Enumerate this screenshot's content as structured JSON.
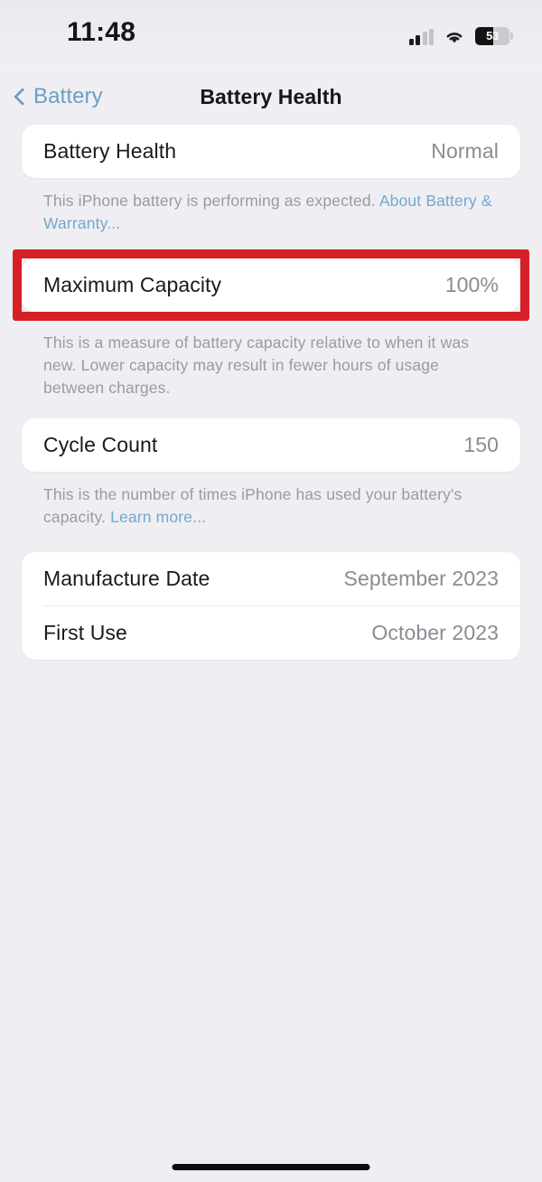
{
  "status_bar": {
    "time": "11:48",
    "signal_icon": "cellular-signal-icon",
    "signal_bars_active": 2,
    "signal_bars_total": 4,
    "wifi_icon": "wifi-icon",
    "battery_icon": "battery-icon",
    "battery_percent_label": "53",
    "battery_percent_value": 53
  },
  "nav": {
    "back_label": "Battery",
    "back_icon": "chevron-left-icon",
    "title": "Battery Health"
  },
  "sections": {
    "battery_health": {
      "row": {
        "label": "Battery Health",
        "value": "Normal"
      },
      "footnote_text": "This iPhone battery is performing as expected. ",
      "footnote_link": "About Battery & Warranty..."
    },
    "maximum_capacity": {
      "row": {
        "label": "Maximum Capacity",
        "value": "100%"
      },
      "footnote_text": "This is a measure of battery capacity relative to when it was new. Lower capacity may result in fewer hours of usage between charges.",
      "highlighted": true,
      "highlight_color": "#d61f26"
    },
    "cycle_count": {
      "row": {
        "label": "Cycle Count",
        "value": "150"
      },
      "footnote_text": "This is the number of times iPhone has used your battery's capacity. ",
      "footnote_link": "Learn more..."
    },
    "dates": {
      "rows": [
        {
          "label": "Manufacture Date",
          "value": "September 2023"
        },
        {
          "label": "First Use",
          "value": "October 2023"
        }
      ]
    }
  },
  "home_indicator": "home-indicator"
}
